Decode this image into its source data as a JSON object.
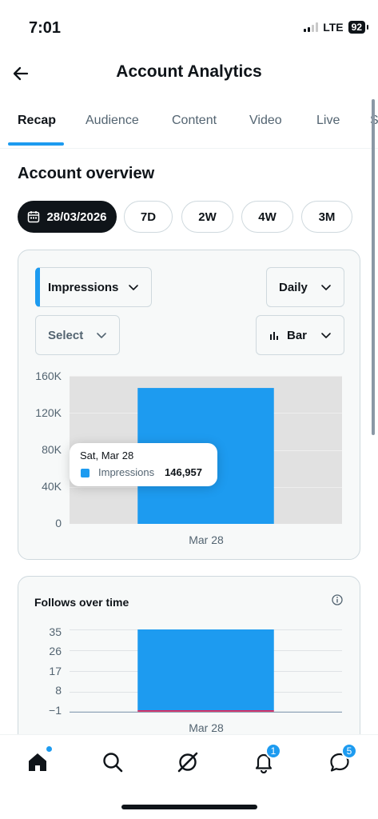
{
  "status_bar": {
    "time": "7:01",
    "network": "LTE",
    "battery": "92"
  },
  "header": {
    "title": "Account Analytics"
  },
  "tabs": [
    {
      "label": "Recap",
      "active": true
    },
    {
      "label": "Audience",
      "active": false
    },
    {
      "label": "Content",
      "active": false
    },
    {
      "label": "Video",
      "active": false
    },
    {
      "label": "Live",
      "active": false
    },
    {
      "label": "S",
      "active": false
    }
  ],
  "overview": {
    "title": "Account overview",
    "date_range": {
      "selected": "28/03/2026",
      "options": [
        "7D",
        "2W",
        "4W",
        "3M"
      ]
    }
  },
  "impressions_card": {
    "metric_dropdown": "Impressions",
    "interval_dropdown": "Daily",
    "compare_dropdown": "Select",
    "chart_type_dropdown": "Bar",
    "tooltip": {
      "date": "Sat, Mar 28",
      "series": "Impressions",
      "value": "146,957"
    },
    "accent_color": "#1d9bf0"
  },
  "follows_card": {
    "title": "Follows over time"
  },
  "bottom_nav": {
    "notifications_badge": "1",
    "messages_badge": "5"
  },
  "chart_data": [
    {
      "type": "bar",
      "categories": [
        "Mar 28"
      ],
      "series": [
        {
          "name": "Impressions",
          "values": [
            146957
          ],
          "color": "#1d9bf0"
        }
      ],
      "yticks": [
        "160K",
        "120K",
        "80K",
        "40K",
        "0"
      ],
      "ylim": [
        0,
        160000
      ],
      "grid": true
    },
    {
      "type": "bar",
      "title": "Follows over time",
      "categories": [
        "Mar 28"
      ],
      "series": [
        {
          "values": [
            35
          ],
          "color": "#1d9bf0"
        }
      ],
      "yticks": [
        "35",
        "26",
        "17",
        "8",
        "−1"
      ],
      "ylim": [
        -1,
        35
      ],
      "grid": true
    }
  ]
}
